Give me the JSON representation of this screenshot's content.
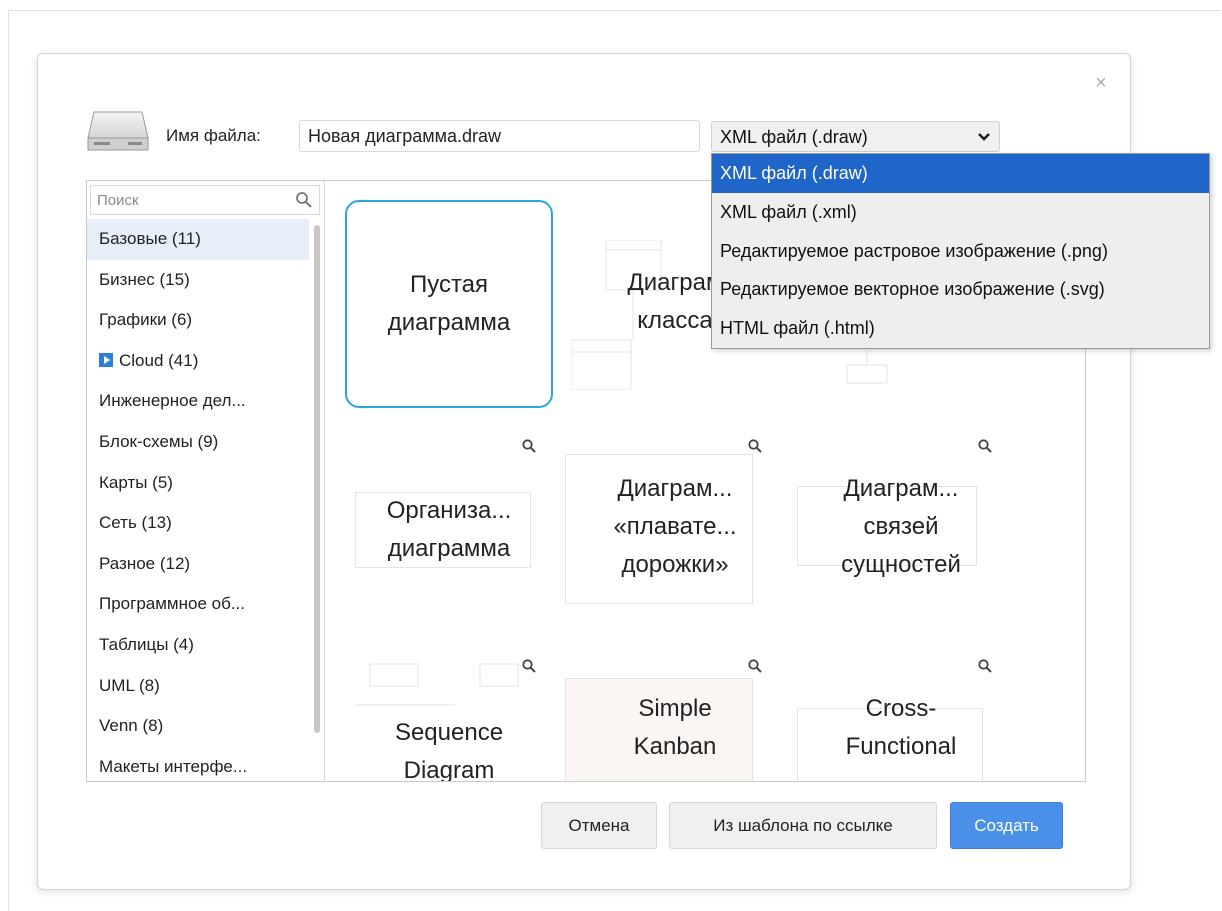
{
  "dialog": {
    "close_symbol": "×",
    "filename_label": "Имя файла:",
    "filename_value": "Новая диаграмма.draw",
    "format_selected": "XML файл (.draw)",
    "format_options": [
      "XML файл (.draw)",
      "XML файл (.xml)",
      "Редактируемое растровое изображение (.png)",
      "Редактируемое векторное изображение (.svg)",
      "HTML файл (.html)"
    ]
  },
  "sidebar": {
    "search_placeholder": "Поиск",
    "categories": [
      "Базовые (11)",
      "Бизнес (15)",
      "Графики (6)",
      "Cloud (41)",
      "Инженерное дел...",
      "Блок-схемы (9)",
      "Карты (5)",
      "Сеть (13)",
      "Разное (12)",
      "Программное об...",
      "Таблицы (4)",
      "UML (8)",
      "Venn (8)",
      "Макеты интерфе..."
    ]
  },
  "templates": [
    {
      "title_lines": [
        "Пустая",
        "диаграмма"
      ]
    },
    {
      "title_lines": [
        "Диаграм",
        "класса"
      ]
    },
    {
      "title_lines": [
        ""
      ]
    },
    {
      "title_lines": [
        "Организа...",
        "диаграмма"
      ]
    },
    {
      "title_lines": [
        "Диаграм...",
        "«плавате...",
        "дорожки»"
      ]
    },
    {
      "title_lines": [
        "Диаграм...",
        "связей",
        "сущностей"
      ]
    },
    {
      "title_lines": [
        "Sequence",
        "Diagram"
      ]
    },
    {
      "title_lines": [
        "Simple",
        "Kanban"
      ]
    },
    {
      "title_lines": [
        "Cross-",
        "Functional"
      ]
    }
  ],
  "buttons": {
    "cancel": "Отмена",
    "from_url": "Из шаблона по ссылке",
    "create": "Создать"
  },
  "colors": {
    "accent": "#4a90e8",
    "selected_option": "#1f66c8",
    "tile_border": "#29a8e0"
  }
}
